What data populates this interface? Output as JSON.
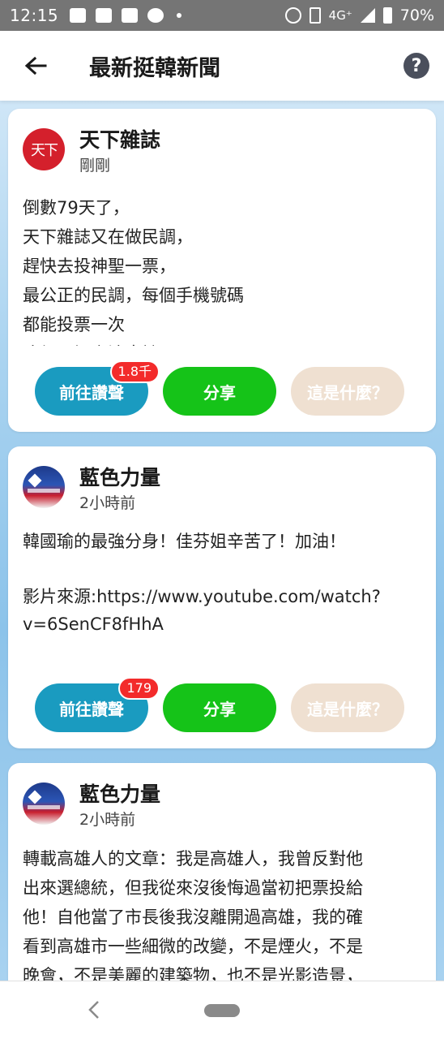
{
  "status_bar": {
    "time": "12:15",
    "network": "4G⁺",
    "battery": "70%"
  },
  "header": {
    "title": "最新挺韓新聞",
    "help_label": "?"
  },
  "posts": [
    {
      "source": "天下雜誌",
      "avatar_text": "天下",
      "time": "剛剛",
      "body": "倒數79天了，\n天下雜誌又在做民調，\n趕快去投神聖一票，\n最公正的民調，每個手機號碼\n都能投票一次\n這個民調方法應該",
      "praise_label": "前往讚聲",
      "praise_count": "1.8千",
      "share_label": "分享",
      "what_label": "這是什麼？"
    },
    {
      "source": "藍色力量",
      "time": "2小時前",
      "body": "韓國瑜的最強分身！佳芬姐辛苦了！加油！\n\n影片來源:https://www.youtube.com/watch?\nv=6SenCF8fHhA",
      "praise_label": "前往讚聲",
      "praise_count": "179",
      "share_label": "分享",
      "what_label": "這是什麼？"
    },
    {
      "source": "藍色力量",
      "time": "2小時前",
      "body": "轉載高雄人的文章：我是高雄人，我曾反對他\n出來選總統，但我從來沒後悔過當初把票投給\n他！自他當了市長後我沒離開過高雄，我的確\n看到高雄市一些細微的改變，不是煙火，不是\n晚會，不是美麗的建築物，也不是光影造景，"
    }
  ],
  "colors": {
    "praise": "#1a9bc0",
    "share": "#15c318",
    "what": "#efe0d1",
    "badge": "#f32b2b"
  }
}
